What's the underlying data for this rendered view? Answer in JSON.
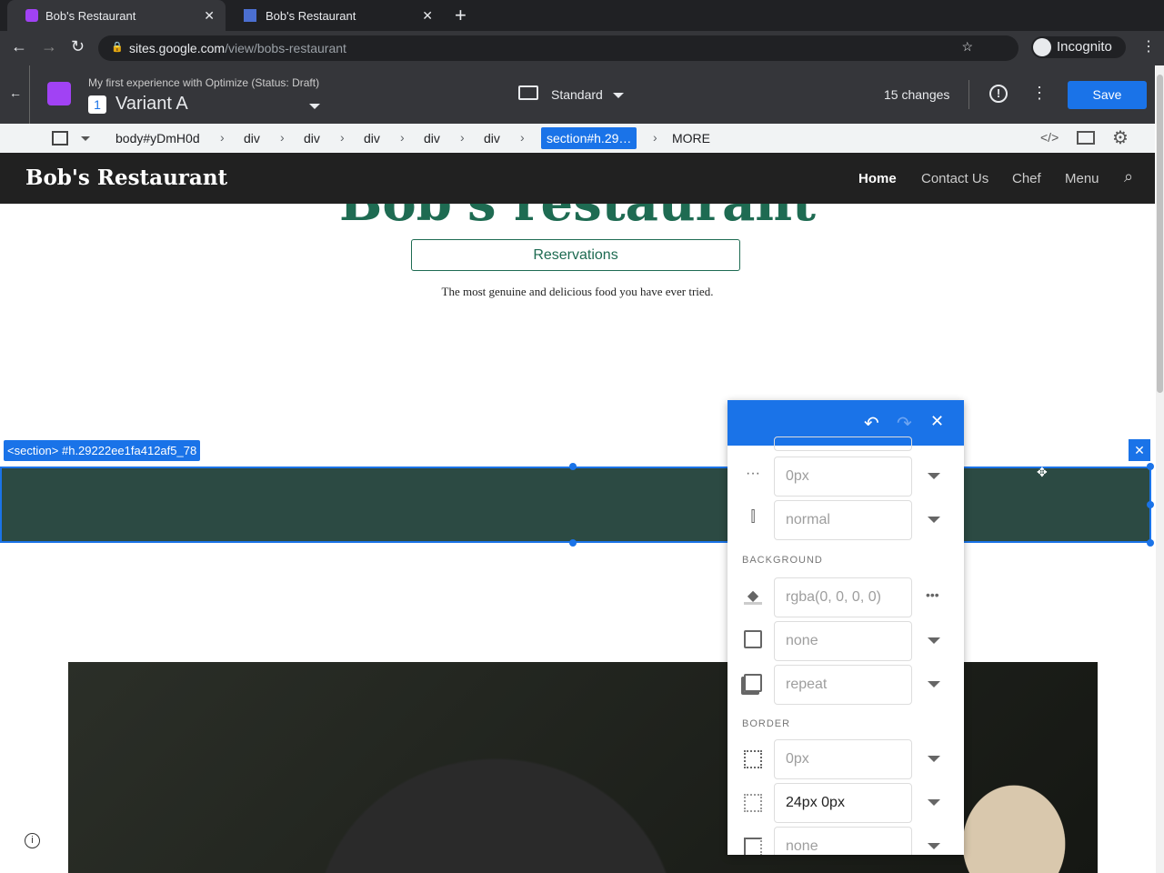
{
  "browser": {
    "tabs": [
      {
        "title": "Bob's Restaurant"
      },
      {
        "title": "Bob's Restaurant"
      }
    ],
    "url_host": "sites.google.com",
    "url_path": "/view/bobs-restaurant",
    "profile": "Incognito"
  },
  "optimize": {
    "experience": "My first experience with Optimize (Status: Draft)",
    "variant_number": "1",
    "variant": "Variant A",
    "device": "Standard",
    "changes": "15 changes",
    "save": "Save"
  },
  "breadcrumbs": [
    "body#yDmH0d",
    "div",
    "div",
    "div",
    "div",
    "div",
    "section#h.29…",
    "MORE"
  ],
  "site": {
    "name": "Bob's Restaurant",
    "nav": [
      "Home",
      "Contact Us",
      "Chef",
      "Menu"
    ],
    "hero_title": "Bob's restaurant",
    "reservations": "Reservations",
    "tagline": "The most genuine and delicious food you have ever tried."
  },
  "selection": {
    "label": "<section> #h.29222ee1fa412af5_78"
  },
  "panel": {
    "spacing_value": "0px",
    "direction_value": "normal",
    "background_header": "BACKGROUND",
    "bg_color": "rgba(0, 0, 0, 0)",
    "bg_image": "none",
    "bg_repeat": "repeat",
    "border_header": "BORDER",
    "border_width": "0px",
    "border_padding": "24px 0px",
    "border_style": "none"
  },
  "colors": {
    "accent": "#1a73e8",
    "section": "#2c4a43",
    "brand_green": "#1e6b52"
  }
}
